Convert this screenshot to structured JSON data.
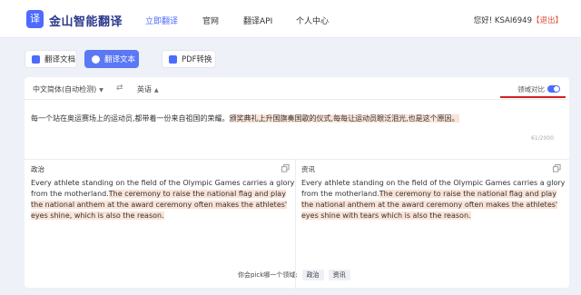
{
  "header": {
    "logo_glyph": "译",
    "brand": "金山智能翻译",
    "nav": [
      "立即翻译",
      "官网",
      "翻译API",
      "个人中心"
    ],
    "greeting": "您好! KSAI6949",
    "logout": "【退出】"
  },
  "modes": [
    "翻译文档",
    "翻译文本",
    "PDF转换"
  ],
  "toolbar": {
    "source_lang": "中文简体(自动检测)",
    "swap": "⇄",
    "target_lang": "英语",
    "toggle_label": "领域对比",
    "toggle_on": true
  },
  "source": {
    "plain": "每一个站在奥运赛场上的运动员,都带着一份来自祖国的荣耀。",
    "highlight": "颁奖典礼上升国旗奏国歌的仪式,每每让运动员眼泛泪光,也是这个原因。",
    "counter": "61/2000"
  },
  "results": [
    {
      "label": "政治",
      "plain": "Every athlete standing on the field of the Olympic Games carries a glory from the motherland.",
      "highlight": "The ceremony to raise the national flag and play the national anthem at the award ceremony often makes the athletes' eyes shine, which is also the reason."
    },
    {
      "label": "资讯",
      "plain": "Every athlete standing on the field of the Olympic Games carries a glory from the motherland.",
      "highlight": "The ceremony to raise the national flag and play the national anthem at the award ceremony often makes the athletes' eyes shine with tears which is also the reason."
    }
  ],
  "pick": {
    "prompt": "你会pick哪一个领域:",
    "options": [
      "政治",
      "资讯"
    ]
  },
  "colors": {
    "accent": "#4d6bfe",
    "highlight": "#fbe3d6",
    "alert_line": "#d32020",
    "logout": "#e04a3a"
  }
}
